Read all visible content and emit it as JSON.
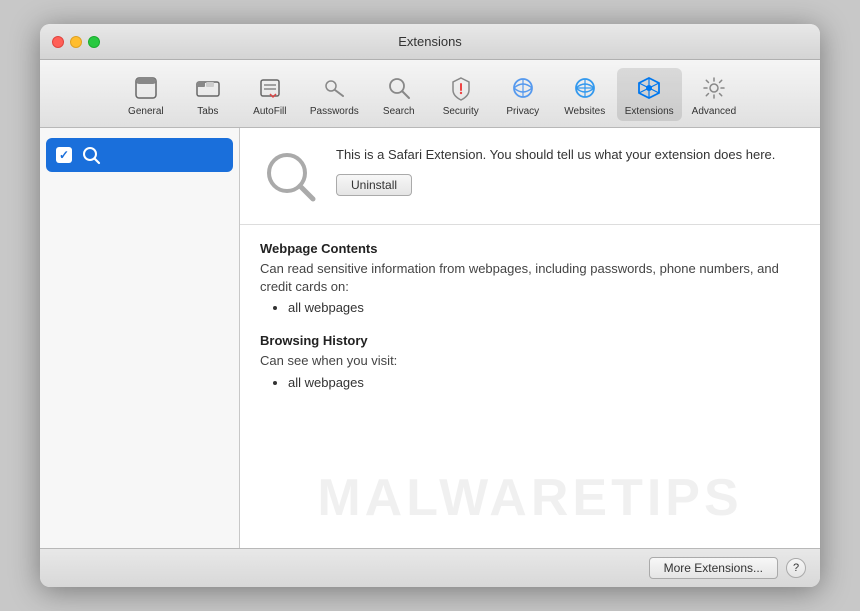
{
  "window": {
    "title": "Extensions"
  },
  "toolbar": {
    "items": [
      {
        "id": "general",
        "label": "General",
        "icon": "general"
      },
      {
        "id": "tabs",
        "label": "Tabs",
        "icon": "tabs"
      },
      {
        "id": "autofill",
        "label": "AutoFill",
        "icon": "autofill"
      },
      {
        "id": "passwords",
        "label": "Passwords",
        "icon": "passwords"
      },
      {
        "id": "search",
        "label": "Search",
        "icon": "search"
      },
      {
        "id": "security",
        "label": "Security",
        "icon": "security"
      },
      {
        "id": "privacy",
        "label": "Privacy",
        "icon": "privacy"
      },
      {
        "id": "websites",
        "label": "Websites",
        "icon": "websites"
      },
      {
        "id": "extensions",
        "label": "Extensions",
        "icon": "extensions",
        "active": true
      },
      {
        "id": "advanced",
        "label": "Advanced",
        "icon": "advanced"
      }
    ]
  },
  "sidebar": {
    "items": [
      {
        "id": "search-ext",
        "label": "Search",
        "enabled": true,
        "selected": true
      }
    ]
  },
  "extension_detail": {
    "description": "This is a Safari Extension. You should tell us what your extension does here.",
    "uninstall_label": "Uninstall",
    "permissions": [
      {
        "title": "Webpage Contents",
        "description": "Can read sensitive information from webpages, including passwords, phone numbers, and credit cards on:",
        "items": [
          "all webpages"
        ]
      },
      {
        "title": "Browsing History",
        "description": "Can see when you visit:",
        "items": [
          "all webpages"
        ]
      }
    ]
  },
  "footer": {
    "more_extensions_label": "More Extensions...",
    "help_label": "?"
  },
  "watermark": {
    "text": "MALWARETIPS"
  }
}
